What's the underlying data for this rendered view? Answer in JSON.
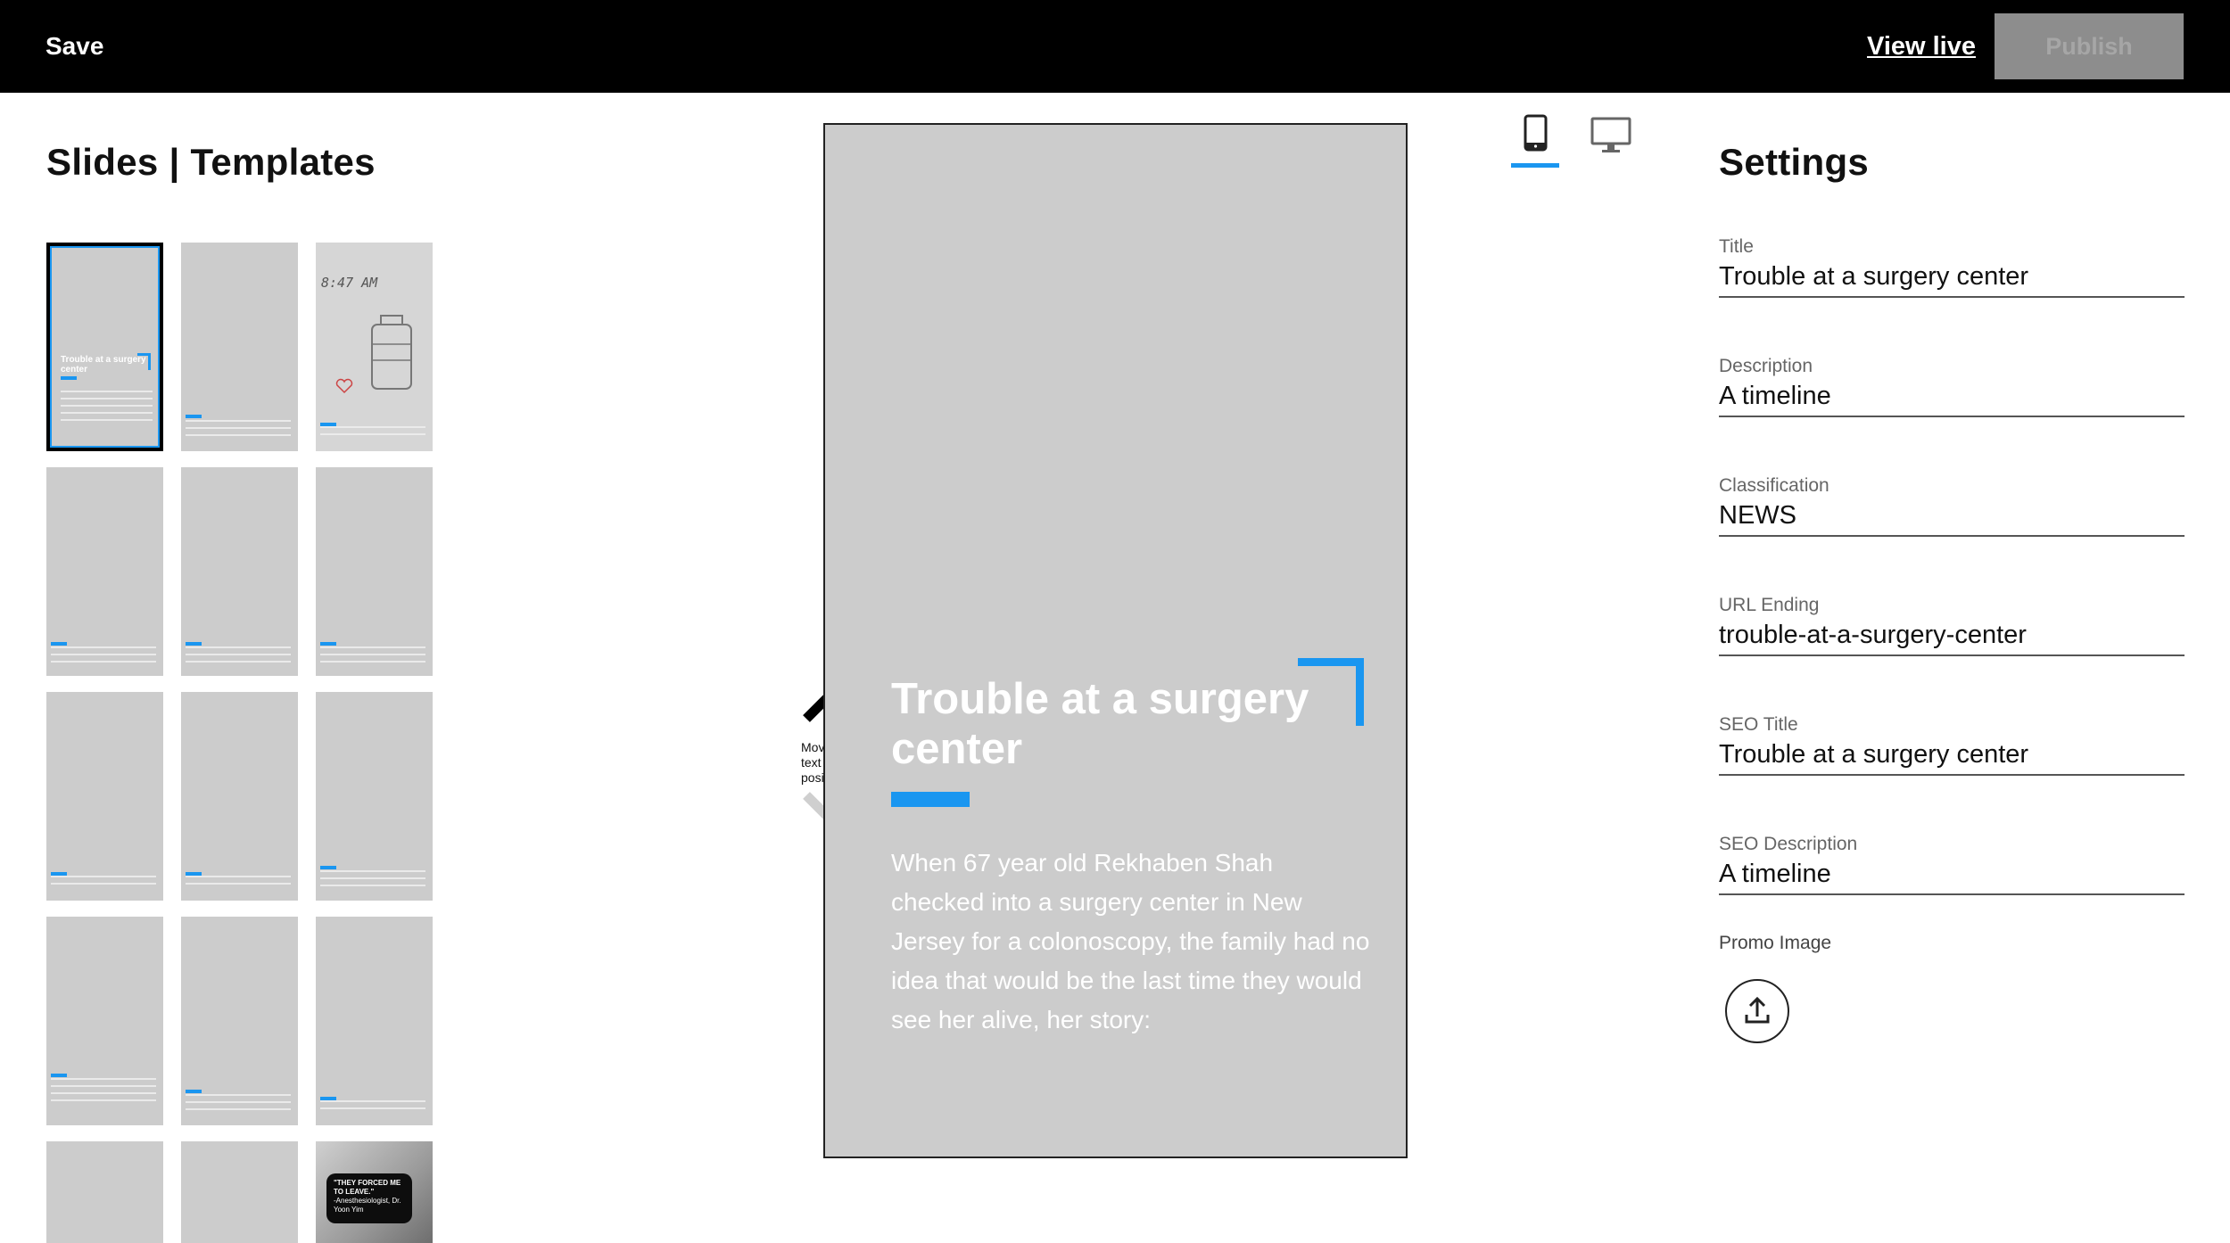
{
  "topbar": {
    "save_label": "Save",
    "view_live_label": "View live",
    "publish_label": "Publish"
  },
  "left_panel": {
    "title": "Slides | Templates",
    "thumb1_title": "Trouble at a surgery center",
    "clock_text": "8:47 AM",
    "bubble_quote": "\"THEY FORCED ME TO LEAVE.\"",
    "bubble_attribution": "-Anesthesiologist, Dr. Yoon Yim"
  },
  "preview": {
    "story_title": "Trouble at a surgery center",
    "story_body": "When 67 year old Rekhaben Shah checked into a surgery center in New Jersey for a colonoscopy, the family had no idea that would be the last time they would see her alive, her story:",
    "move_label": "Move the text position"
  },
  "settings": {
    "title": "Settings",
    "fields": [
      {
        "label": "Title",
        "value": "Trouble at a surgery center"
      },
      {
        "label": "Description",
        "value": "A timeline"
      },
      {
        "label": "Classification",
        "value": "NEWS"
      },
      {
        "label": "URL Ending",
        "value": "trouble-at-a-surgery-center"
      },
      {
        "label": "SEO Title",
        "value": "Trouble at a surgery center"
      },
      {
        "label": "SEO Description",
        "value": "A timeline"
      }
    ],
    "promo_image_label": "Promo Image"
  },
  "colors": {
    "accent": "#1a96f0",
    "topbar": "#000000",
    "slide_bg": "#cccccc",
    "publish_disabled": "#8d8d8d"
  },
  "icons": {
    "device_phone": "phone-icon",
    "device_desktop": "desktop-icon",
    "move_up": "chevron-up-icon",
    "move_down": "chevron-down-icon",
    "upload": "upload-icon"
  }
}
